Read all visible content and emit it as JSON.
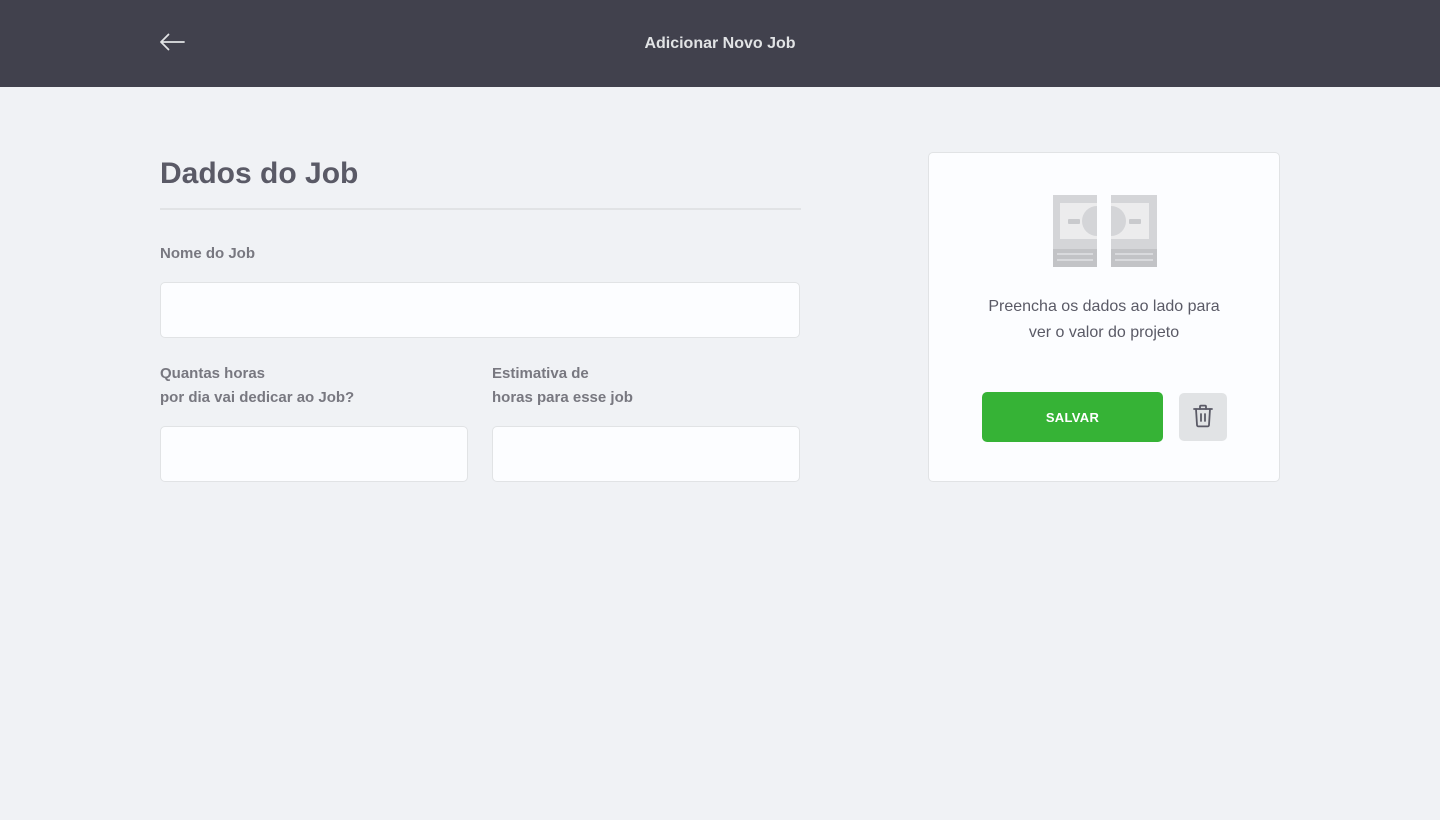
{
  "header": {
    "title": "Adicionar Novo Job",
    "back_icon": "arrow-left-icon"
  },
  "form": {
    "section_title": "Dados do Job",
    "name_label": "Nome do Job",
    "name_value": "",
    "daily_hours_label_line1": "Quantas horas",
    "daily_hours_label_line2": "por dia vai dedicar ao Job?",
    "daily_hours_value": "",
    "total_hours_label_line1": "Estimativa de",
    "total_hours_label_line2": "horas para esse job",
    "total_hours_value": ""
  },
  "summary": {
    "icon": "money-icon",
    "text_line1": "Preencha os dados ao lado para",
    "text_line2": "ver o valor do projeto",
    "save_label": "SALVAR",
    "delete_icon": "trash-icon"
  },
  "colors": {
    "header_bg": "#41414d",
    "page_bg": "#f0f2f5",
    "accent_green": "#36b336",
    "text_dark": "#5a5a66",
    "text_muted": "#787880"
  }
}
